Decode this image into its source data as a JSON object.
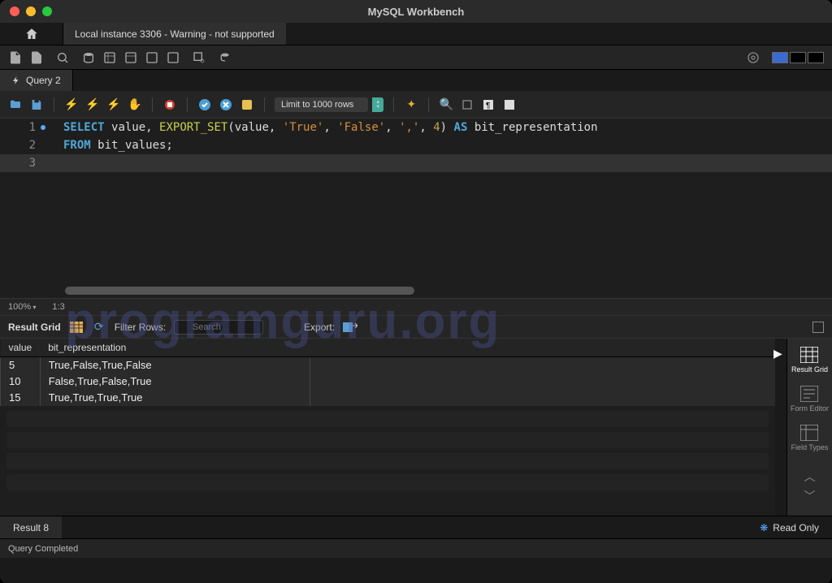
{
  "app_title": "MySQL Workbench",
  "connection_tab": "Local instance 3306 - Warning - not supported",
  "query_tab": "Query 2",
  "limit_label": "Limit to 1000 rows",
  "sql": {
    "lines": [
      {
        "n": "1",
        "parts": [
          {
            "t": "SELECT ",
            "c": "kw"
          },
          {
            "t": "value, ",
            "c": "id"
          },
          {
            "t": "EXPORT_SET",
            "c": "fn"
          },
          {
            "t": "(value, ",
            "c": "id"
          },
          {
            "t": "'True'",
            "c": "str"
          },
          {
            "t": ", ",
            "c": "id"
          },
          {
            "t": "'False'",
            "c": "str"
          },
          {
            "t": ", ",
            "c": "id"
          },
          {
            "t": "','",
            "c": "str"
          },
          {
            "t": ", ",
            "c": "id"
          },
          {
            "t": "4",
            "c": "num"
          },
          {
            "t": ") ",
            "c": "id"
          },
          {
            "t": "AS",
            "c": "kw"
          },
          {
            "t": " bit_representation",
            "c": "id"
          }
        ]
      },
      {
        "n": "2",
        "parts": [
          {
            "t": "FROM",
            "c": "kw"
          },
          {
            "t": " bit_values;",
            "c": "id"
          }
        ]
      },
      {
        "n": "3",
        "parts": []
      }
    ]
  },
  "zoom": "100%",
  "cursor_pos": "1:3",
  "result_grid_label": "Result Grid",
  "filter_label": "Filter Rows:",
  "filter_placeholder": "Search",
  "export_label": "Export:",
  "columns": [
    "value",
    "bit_representation"
  ],
  "rows": [
    {
      "value": "5",
      "bit_representation": "True,False,True,False"
    },
    {
      "value": "10",
      "bit_representation": "False,True,False,True"
    },
    {
      "value": "15",
      "bit_representation": "True,True,True,True"
    }
  ],
  "side_tabs": {
    "result": "Result Grid",
    "form": "Form Editor",
    "field": "Field Types"
  },
  "result_tab": "Result 8",
  "read_only": "Read Only",
  "status": "Query Completed",
  "watermark": "programguru.org"
}
